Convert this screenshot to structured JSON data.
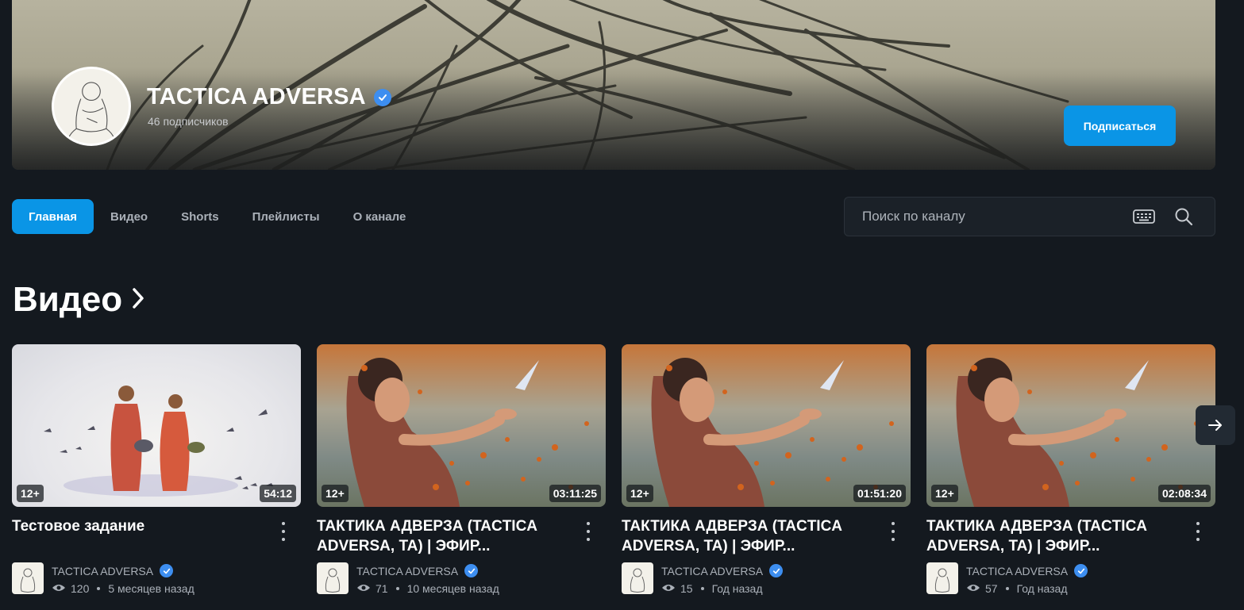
{
  "channel": {
    "name": "TACTICA ADVERSA",
    "subscribers": "46 подписчиков",
    "subscribe_label": "Подписаться"
  },
  "tabs": [
    {
      "label": "Главная",
      "active": true
    },
    {
      "label": "Видео"
    },
    {
      "label": "Shorts"
    },
    {
      "label": "Плейлисты"
    },
    {
      "label": "О канале"
    }
  ],
  "search": {
    "placeholder": "Поиск по каналу",
    "icons": [
      "keyboard-icon",
      "search-icon"
    ]
  },
  "section": {
    "title": "Видео",
    "icon": "chevron-right-icon"
  },
  "videos": [
    {
      "title": "Тестовое задание",
      "age": "12+",
      "duration": "54:12",
      "channel": "TACTICA ADVERSA",
      "views": "120",
      "posted": "5 месяцев назад"
    },
    {
      "title": "ТАКТИКА АДВЕРЗА (TACTICA ADVERSA, TA)  |  ЭФИР...",
      "age": "12+",
      "duration": "03:11:25",
      "channel": "TACTICA ADVERSA",
      "views": "71",
      "posted": "10 месяцев назад"
    },
    {
      "title": "ТАКТИКА АДВЕРЗА (TACTICA ADVERSA, TA) | ЭФИР...",
      "age": "12+",
      "duration": "01:51:20",
      "channel": "TACTICA ADVERSA",
      "views": "15",
      "posted": "Год назад"
    },
    {
      "title": "ТАКТИКА АДВЕРЗА (TACTICA ADVERSA, TA) | ЭФИР...",
      "age": "12+",
      "duration": "02:08:34",
      "channel": "TACTICA ADVERSA",
      "views": "57",
      "posted": "Год назад"
    }
  ],
  "colors": {
    "accent": "#0a95e6",
    "background": "#14191f",
    "verified": "#3d8ef0"
  }
}
